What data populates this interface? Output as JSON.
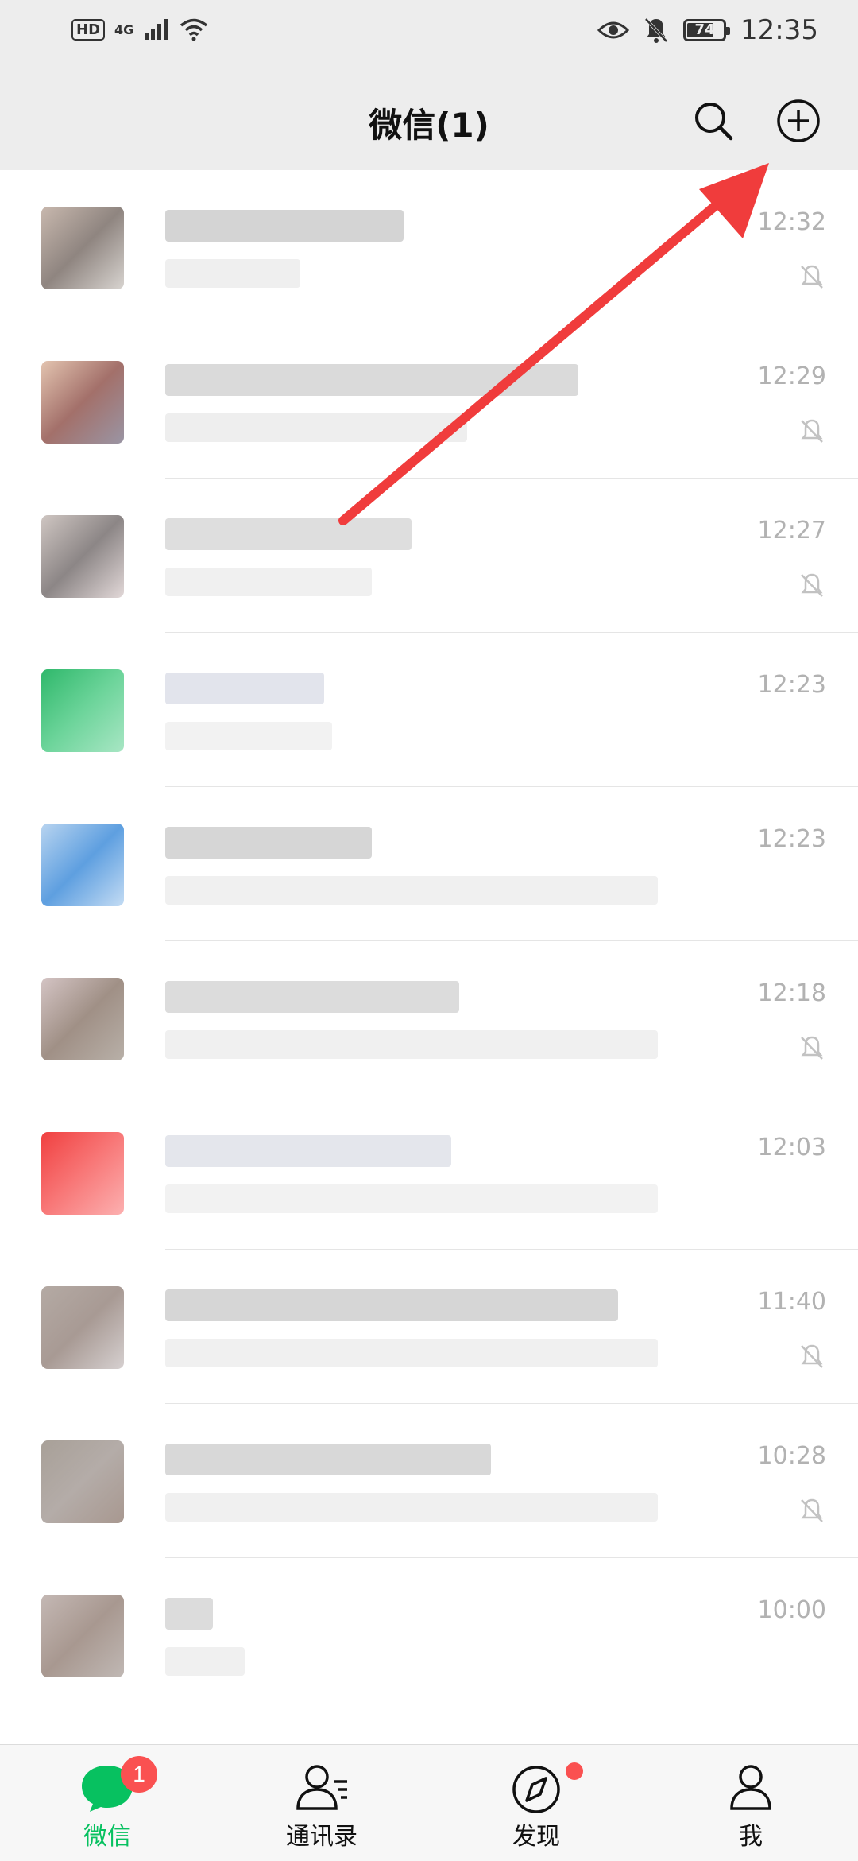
{
  "status_bar": {
    "hd": "HD",
    "network": "4G",
    "battery": "74",
    "battery_level": 0.74,
    "time": "12:35"
  },
  "header": {
    "title": "微信(1)",
    "icons": [
      "search-icon",
      "plus-circle-icon"
    ]
  },
  "chats": [
    {
      "time": "12:32",
      "muted": true
    },
    {
      "time": "12:29",
      "muted": true
    },
    {
      "time": "12:27",
      "muted": true
    },
    {
      "time": "12:23",
      "muted": false
    },
    {
      "time": "12:23",
      "muted": false
    },
    {
      "time": "12:18",
      "muted": true
    },
    {
      "time": "12:03",
      "muted": false
    },
    {
      "time": "11:40",
      "muted": true
    },
    {
      "time": "10:28",
      "muted": true
    },
    {
      "time": "10:00",
      "muted": false
    }
  ],
  "tabs": [
    {
      "label": "微信",
      "icon": "chat-bubble-icon",
      "active": true,
      "badge": "1"
    },
    {
      "label": "通讯录",
      "icon": "contacts-icon",
      "active": false
    },
    {
      "label": "发现",
      "icon": "compass-icon",
      "active": false,
      "dot": true
    },
    {
      "label": "我",
      "icon": "person-icon",
      "active": false
    }
  ],
  "colors": {
    "accent": "#07c160",
    "badge": "#fa5151",
    "annotation_arrow": "#f03c3c",
    "header_bg": "#ededed"
  }
}
